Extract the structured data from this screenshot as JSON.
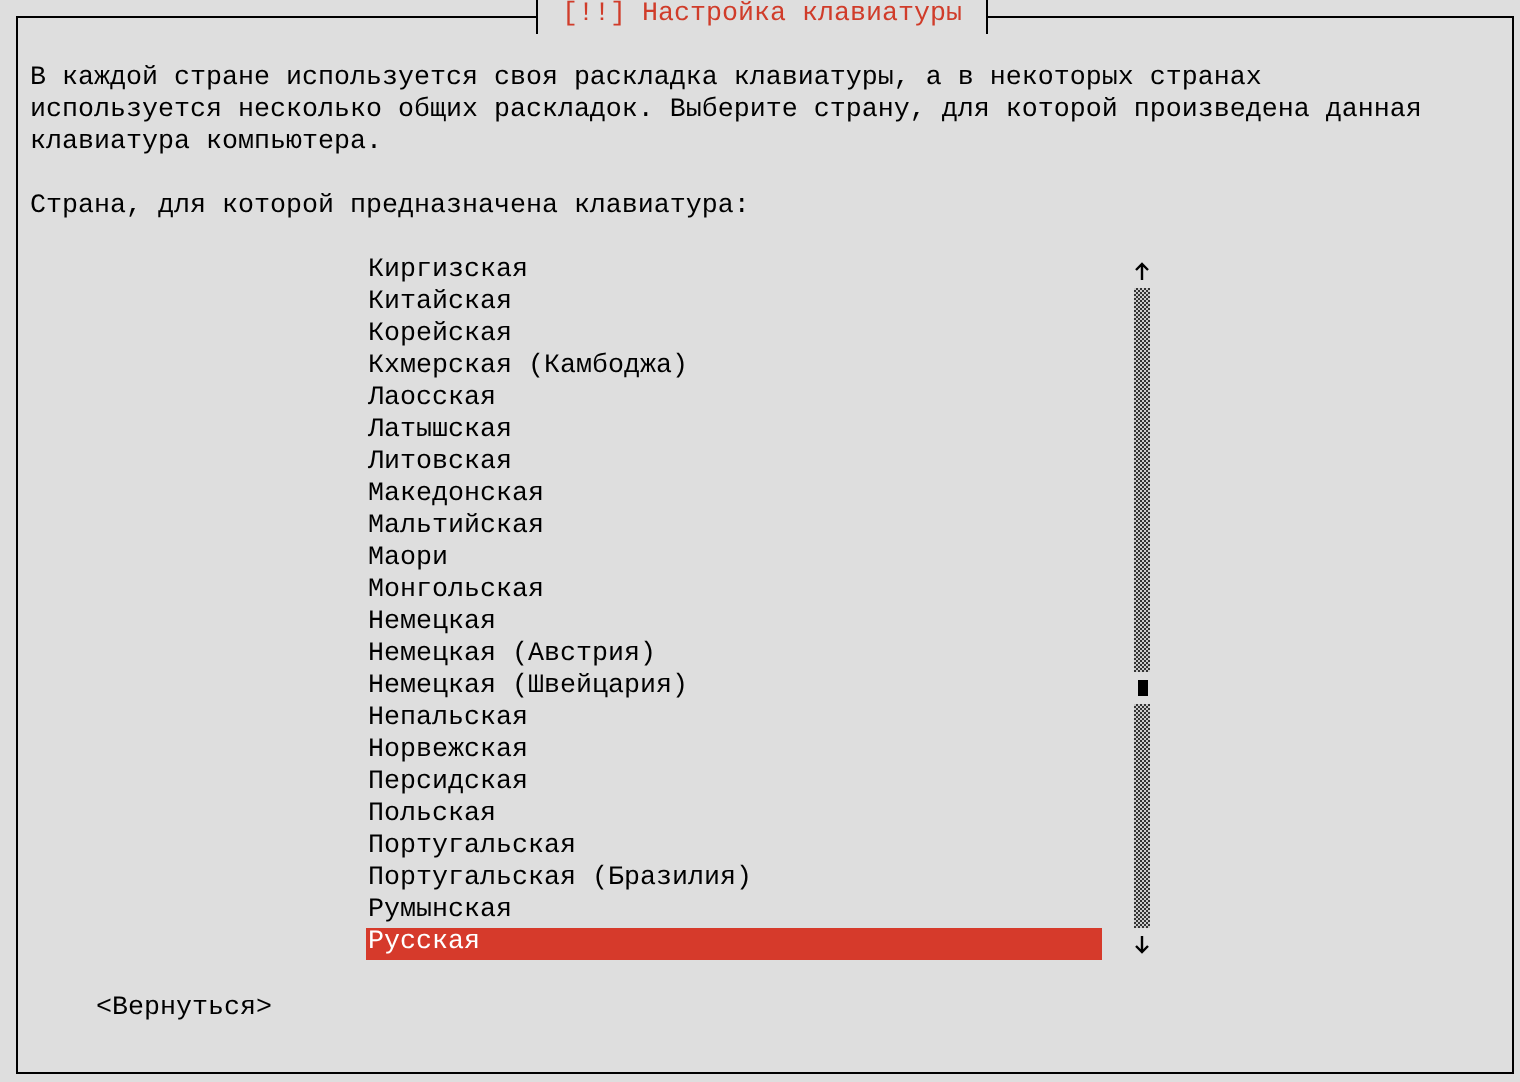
{
  "window": {
    "title": "[!!] Настройка клавиатуры"
  },
  "description": [
    "В каждой стране используется своя раскладка клавиатуры, а в некоторых странах",
    "используется несколько общих раскладок. Выберите страну, для которой произведена данная",
    "клавиатура компьютера."
  ],
  "prompt": "Страна, для которой предназначена клавиатура:",
  "list": {
    "items": [
      {
        "label": "Киргизская",
        "selected": false
      },
      {
        "label": "Китайская",
        "selected": false
      },
      {
        "label": "Корейская",
        "selected": false
      },
      {
        "label": "Кхмерская (Камбоджа)",
        "selected": false
      },
      {
        "label": "Лаосская",
        "selected": false
      },
      {
        "label": "Латышская",
        "selected": false
      },
      {
        "label": "Литовская",
        "selected": false
      },
      {
        "label": "Македонская",
        "selected": false
      },
      {
        "label": "Мальтийская",
        "selected": false
      },
      {
        "label": "Маори",
        "selected": false
      },
      {
        "label": "Монгольская",
        "selected": false
      },
      {
        "label": "Немецкая",
        "selected": false
      },
      {
        "label": "Немецкая (Австрия)",
        "selected": false
      },
      {
        "label": "Немецкая (Швейцария)",
        "selected": false
      },
      {
        "label": "Непальская",
        "selected": false
      },
      {
        "label": "Норвежская",
        "selected": false
      },
      {
        "label": "Персидская",
        "selected": false
      },
      {
        "label": "Польская",
        "selected": false
      },
      {
        "label": "Португальская",
        "selected": false
      },
      {
        "label": "Португальская (Бразилия)",
        "selected": false
      },
      {
        "label": "Румынская",
        "selected": false
      },
      {
        "label": "Русская",
        "selected": true
      }
    ]
  },
  "buttons": [
    "<Вернуться>"
  ]
}
